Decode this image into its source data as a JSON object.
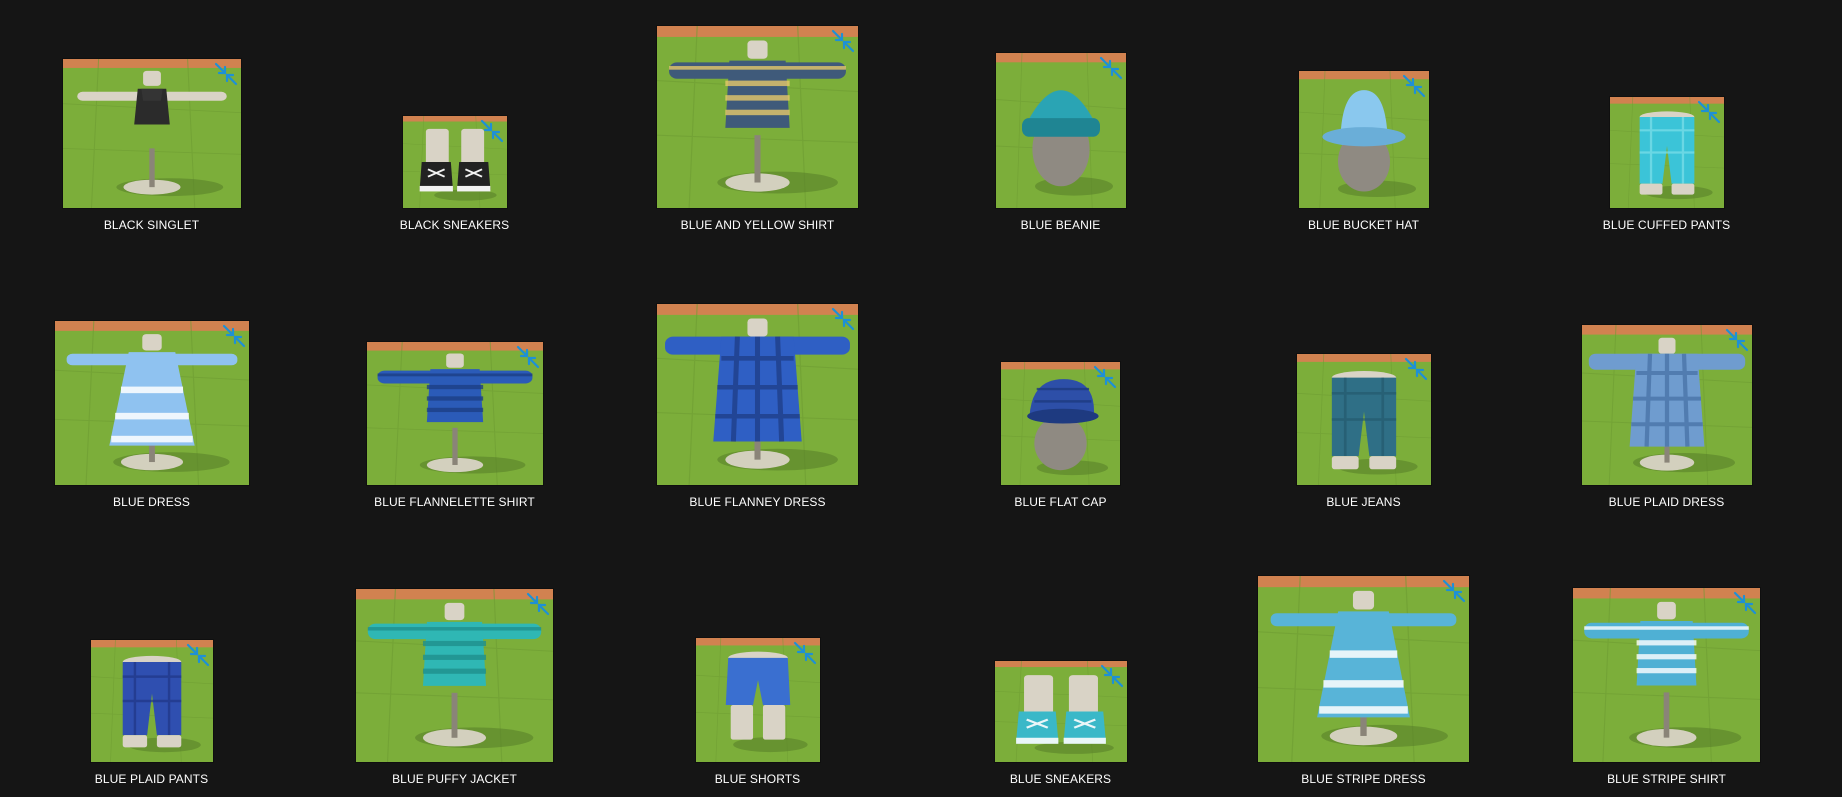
{
  "colors": {
    "background": "#151515",
    "grass": "#7cae3a",
    "ground_edge": "#e07a55",
    "mannequin": "#d9d3c6",
    "badge": "#1e90d6",
    "label": "#ffffff"
  },
  "items": [
    {
      "label": "BLACK SINGLET",
      "kind": "singlet",
      "color": "#2b2b2b",
      "accent": "#3a3a3a",
      "badge_icon": "resize-arrows-icon"
    },
    {
      "label": "BLACK SNEAKERS",
      "kind": "sneakers",
      "color": "#222222",
      "accent": "#f2f2f2",
      "badge_icon": "resize-arrows-icon"
    },
    {
      "label": "BLUE AND YELLOW SHIRT",
      "kind": "shirt",
      "color": "#3f5a7a",
      "accent": "#e6c86a",
      "badge_icon": "resize-arrows-icon"
    },
    {
      "label": "BLUE BEANIE",
      "kind": "beanie",
      "color": "#2aa4b4",
      "accent": "#1f8593",
      "badge_icon": "resize-arrows-icon"
    },
    {
      "label": "BLUE BUCKET HAT",
      "kind": "buckethat",
      "color": "#8ac8ee",
      "accent": "#6aaed8",
      "badge_icon": "resize-arrows-icon"
    },
    {
      "label": "BLUE CUFFED PANTS",
      "kind": "pants",
      "color": "#3bc4d8",
      "accent": "#7fe0ea",
      "badge_icon": "resize-arrows-icon"
    },
    {
      "label": "BLUE DRESS",
      "kind": "dress",
      "color": "#8fc2f0",
      "accent": "#ffffff",
      "badge_icon": "resize-arrows-icon"
    },
    {
      "label": "BLUE FLANNELETTE SHIRT",
      "kind": "shirt",
      "color": "#2b5bb8",
      "accent": "#1d3f85",
      "badge_icon": "resize-arrows-icon"
    },
    {
      "label": "BLUE FLANNEY DRESS",
      "kind": "longdress",
      "color": "#2f5fc4",
      "accent": "#1f3f8a",
      "badge_icon": "resize-arrows-icon"
    },
    {
      "label": "BLUE FLAT CAP",
      "kind": "flatcap",
      "color": "#2d4fa8",
      "accent": "#1e3a80",
      "badge_icon": "resize-arrows-icon"
    },
    {
      "label": "BLUE JEANS",
      "kind": "pants",
      "color": "#2f6f86",
      "accent": "#245a6d",
      "badge_icon": "resize-arrows-icon"
    },
    {
      "label": "BLUE PLAID DRESS",
      "kind": "longdress",
      "color": "#6f9ccf",
      "accent": "#4a74a8",
      "badge_icon": "resize-arrows-icon"
    },
    {
      "label": "BLUE PLAID PANTS",
      "kind": "pants",
      "color": "#2f4fb0",
      "accent": "#1f3686",
      "badge_icon": "resize-arrows-icon"
    },
    {
      "label": "BLUE PUFFY JACKET",
      "kind": "shirt",
      "color": "#2fb7b4",
      "accent": "#1f8f8c",
      "badge_icon": "resize-arrows-icon"
    },
    {
      "label": "BLUE SHORTS",
      "kind": "shorts",
      "color": "#3a6fd0",
      "accent": "#2a54a6",
      "badge_icon": "resize-arrows-icon"
    },
    {
      "label": "BLUE SNEAKERS",
      "kind": "sneakers",
      "color": "#3ab8c8",
      "accent": "#eaf6f8",
      "badge_icon": "resize-arrows-icon"
    },
    {
      "label": "BLUE STRIPE DRESS",
      "kind": "dress",
      "color": "#58b4d8",
      "accent": "#ffffff",
      "badge_icon": "resize-arrows-icon"
    },
    {
      "label": "BLUE STRIPE SHIRT",
      "kind": "shirt",
      "color": "#4fb0d4",
      "accent": "#ffffff",
      "badge_icon": "resize-arrows-icon"
    }
  ]
}
